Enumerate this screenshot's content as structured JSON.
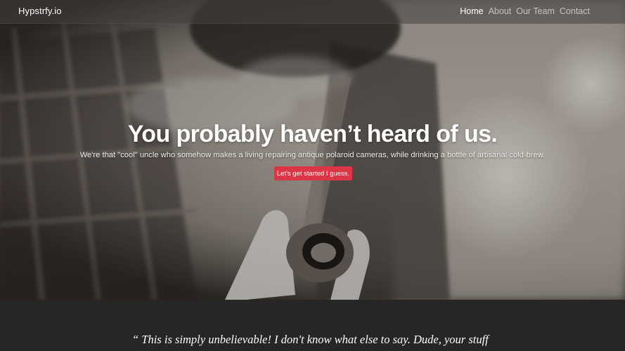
{
  "navbar": {
    "brand": "Hypstrfy.io",
    "items": [
      {
        "label": "Home",
        "active": true
      },
      {
        "label": "About",
        "active": false
      },
      {
        "label": "Our Team",
        "active": false
      },
      {
        "label": "Contact",
        "active": false
      }
    ]
  },
  "hero": {
    "headline": "You probably haven’t heard of us.",
    "lead": "We're that \"cool\" uncle who somehow makes a living repairing antique polaroid cameras, while drinking a bottle of artisanal cold-brew.",
    "cta_label": "Let's get started I guess."
  },
  "testimonial": {
    "quote": "“ This is simply unbelievable! I don't know what else to say. Dude, your stuff"
  },
  "colors": {
    "cta": "#dc3545",
    "section_bg": "#262626"
  }
}
